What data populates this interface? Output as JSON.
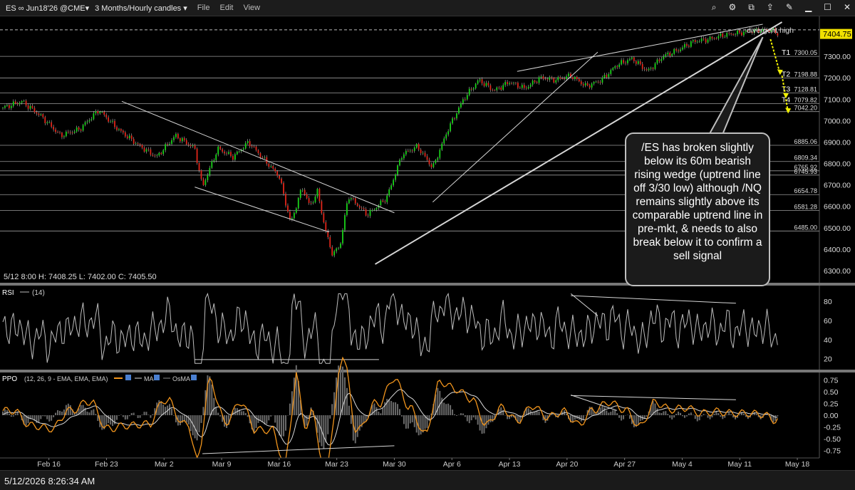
{
  "toolbar": {
    "symbol": "ES ∞ Jun18'26 @CME▾",
    "period": "3 Months/Hourly candles ▾",
    "menu_file": "File",
    "menu_edit": "Edit",
    "menu_view": "View"
  },
  "footer": {
    "timestamp": "5/12/2026 8:26:34 AM"
  },
  "callout": {
    "text": "/ES has broken slightly below its 60m bearish rising wedge (uptrend line off 3/30 low) although /NQ remains slightly above its comparable uptrend line in pre-mkt, & needs to also break below it to confirm a sell signal"
  },
  "chart_data": {
    "type": "line",
    "price_panel": {
      "ohlc_label": "5/12 8:00   H: 7408.25   L: 7402.00   C: 7405.50",
      "last_price": "7404.75",
      "divergent_label": "divergent high",
      "ylim": [
        6250,
        7480
      ],
      "y_ticks": [
        6300,
        6400,
        6500,
        6600,
        6700,
        6800,
        6900,
        7000,
        7100,
        7200,
        7300,
        7400
      ],
      "y_tick_labels": [
        "6300.00",
        "6400.00",
        "6500.00",
        "6600.00",
        "6700.00",
        "6800.00",
        "6900.00",
        "7000.00",
        "7100.00",
        "7200.00",
        "7300.00",
        "7400.00"
      ],
      "levels": [
        {
          "value": 7300.05,
          "label": "7300.05",
          "tag": "T1"
        },
        {
          "value": 7198.88,
          "label": "7198.88",
          "tag": "T2"
        },
        {
          "value": 7128.81,
          "label": "7128.81",
          "tag": "T3"
        },
        {
          "value": 7079.82,
          "label": "7079.82",
          "tag": "T4"
        },
        {
          "value": 7042.2,
          "label": "7042.20",
          "tag": ""
        },
        {
          "value": 6885.06,
          "label": "6885.06",
          "tag": ""
        },
        {
          "value": 6809.34,
          "label": "6809.34",
          "tag": ""
        },
        {
          "value": 6765.92,
          "label": "6765.92",
          "tag": ""
        },
        {
          "value": 6745.93,
          "label": "6745.93",
          "tag": ""
        },
        {
          "value": 6654.78,
          "label": "6654.78",
          "tag": ""
        },
        {
          "value": 6581.28,
          "label": "6581.28",
          "tag": ""
        },
        {
          "value": 6485.0,
          "label": "6485.00",
          "tag": ""
        }
      ],
      "series": [
        {
          "x": [
            0,
            5,
            10,
            15,
            20,
            25,
            30,
            35,
            40,
            45,
            50,
            52,
            56,
            60,
            64,
            68,
            72,
            75,
            78,
            80,
            82,
            84,
            86,
            88,
            90,
            95,
            100
          ],
          "y": [
            7060,
            7090,
            7020,
            6930,
            6960,
            7050,
            6960,
            6890,
            6830,
            6930,
            6870,
            6690,
            6870,
            6830,
            6900,
            6820,
            6740,
            6520,
            6690,
            6600,
            6670,
            6490,
            6370,
            6430,
            6650,
            6560,
            6640
          ]
        },
        {
          "x": [
            100,
            104,
            108,
            112,
            116,
            120,
            124,
            128,
            132,
            136,
            140,
            144,
            148,
            152,
            156,
            160,
            164,
            168,
            172,
            176,
            180,
            184,
            188,
            192,
            196,
            200,
            202
          ],
          "y": [
            6640,
            6840,
            6880,
            6780,
            6960,
            7100,
            7190,
            7140,
            7180,
            7150,
            7200,
            7190,
            7210,
            7160,
            7190,
            7260,
            7290,
            7230,
            7300,
            7330,
            7370,
            7380,
            7400,
            7410,
            7420,
            7425,
            7405
          ]
        }
      ],
      "x_ticks": [
        "Feb 16",
        "Feb 23",
        "Mar 2",
        "Mar 9",
        "Mar 16",
        "Mar 23",
        "Mar 30",
        "Apr 6",
        "Apr 13",
        "Apr 20",
        "Apr 27",
        "May 4",
        "May 11",
        "May 18"
      ]
    },
    "rsi_panel": {
      "label": "RSI",
      "legend": "(14)",
      "ylim": [
        10,
        95
      ],
      "y_ticks": [
        20,
        40,
        60,
        80
      ],
      "y_tick_labels": [
        "20",
        "40",
        "60",
        "80"
      ]
    },
    "ppo_panel": {
      "label": "PPO",
      "legend": "(12, 26, 9 - EMA, EMA, EMA)",
      "legend_ma": "MA",
      "legend_osma": "OsMA",
      "ylim": [
        -0.88,
        0.88
      ],
      "y_ticks": [
        0.75,
        0.5,
        0.25,
        0,
        -0.25,
        -0.5,
        -0.75
      ],
      "y_tick_labels": [
        "0.75",
        "0.50",
        "0.25",
        "0.00",
        "-0.25",
        "-0.50",
        "-0.75"
      ]
    },
    "colors": {
      "up": "#19d219",
      "down": "#e0261a",
      "rsi": "#bdbdbd",
      "ppo": "#f2951c",
      "ma": "#d9d9d9",
      "osma": "#6a6a6a",
      "arrow": "#f0f000"
    }
  }
}
